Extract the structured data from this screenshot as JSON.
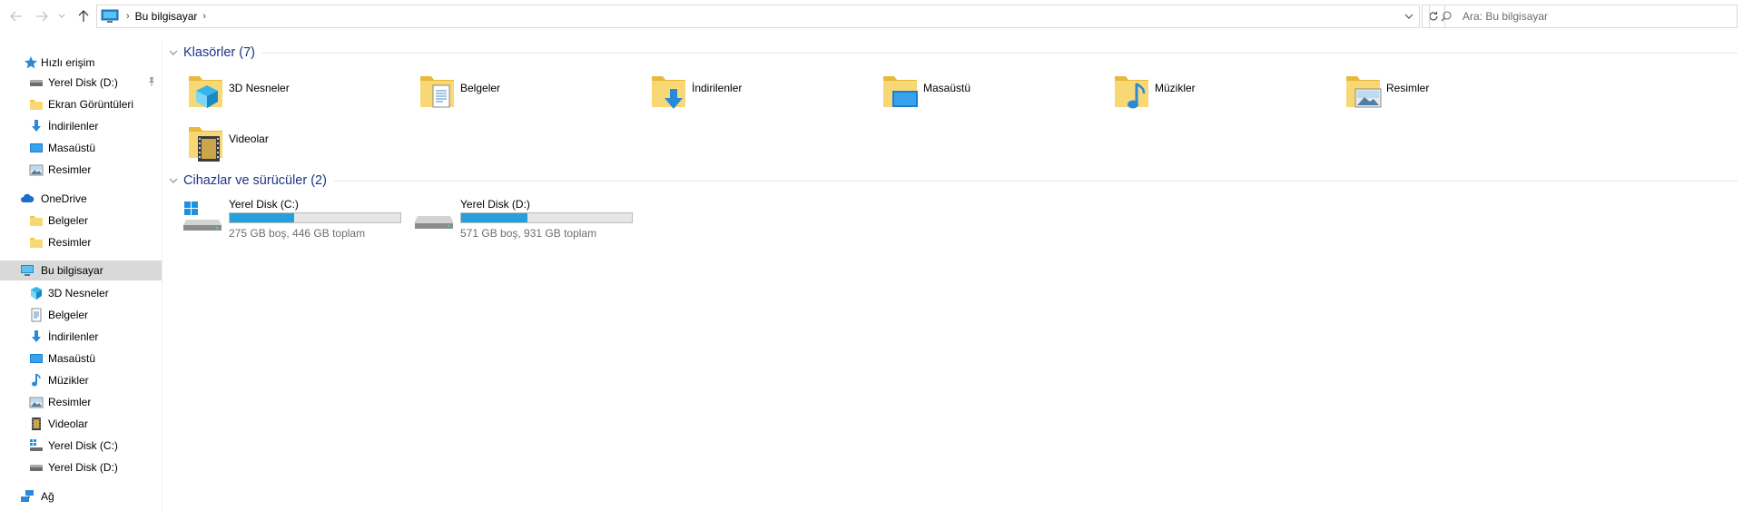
{
  "address_bar": {
    "breadcrumb": [
      "Bu bilgisayar"
    ],
    "search_placeholder": "Ara: Bu bilgisayar"
  },
  "sidebar": {
    "quick_access": {
      "label": "Hızlı erişim",
      "items": [
        {
          "label": "Yerel Disk (D:)",
          "icon": "drive-icon",
          "pinned": true
        },
        {
          "label": "Ekran Görüntüleri",
          "icon": "folder-icon"
        },
        {
          "label": "İndirilenler",
          "icon": "download-arrow-icon"
        },
        {
          "label": "Masaüstü",
          "icon": "desktop-icon"
        },
        {
          "label": "Resimler",
          "icon": "pictures-icon"
        }
      ]
    },
    "onedrive": {
      "label": "OneDrive",
      "items": [
        {
          "label": "Belgeler",
          "icon": "folder-icon"
        },
        {
          "label": "Resimler",
          "icon": "folder-icon"
        }
      ]
    },
    "this_pc": {
      "label": "Bu bilgisayar",
      "selected": true,
      "items": [
        {
          "label": "3D Nesneler",
          "icon": "3d-objects-icon"
        },
        {
          "label": "Belgeler",
          "icon": "documents-icon"
        },
        {
          "label": "İndirilenler",
          "icon": "download-arrow-icon"
        },
        {
          "label": "Masaüstü",
          "icon": "desktop-icon"
        },
        {
          "label": "Müzikler",
          "icon": "music-note-icon"
        },
        {
          "label": "Resimler",
          "icon": "pictures-icon"
        },
        {
          "label": "Videolar",
          "icon": "film-icon"
        },
        {
          "label": "Yerel Disk (C:)",
          "icon": "windows-drive-icon"
        },
        {
          "label": "Yerel Disk (D:)",
          "icon": "drive-icon"
        }
      ]
    },
    "network": {
      "label": "Ağ"
    }
  },
  "content": {
    "folders_group": {
      "title": "Klasörler (7)",
      "items": [
        {
          "label": "3D Nesneler",
          "icon": "3d-objects-folder-icon"
        },
        {
          "label": "Belgeler",
          "icon": "documents-folder-icon"
        },
        {
          "label": "İndirilenler",
          "icon": "downloads-folder-icon"
        },
        {
          "label": "Masaüstü",
          "icon": "desktop-folder-icon"
        },
        {
          "label": "Müzikler",
          "icon": "music-folder-icon"
        },
        {
          "label": "Resimler",
          "icon": "pictures-folder-icon"
        },
        {
          "label": "Videolar",
          "icon": "videos-folder-icon"
        }
      ]
    },
    "drives_group": {
      "title": "Cihazlar ve sürücüler (2)",
      "items": [
        {
          "label": "Yerel Disk (C:)",
          "info": "275 GB boş, 446 GB toplam",
          "used_fraction": 0.38,
          "icon": "windows-drive-icon"
        },
        {
          "label": "Yerel Disk (D:)",
          "info": "571 GB boş, 931 GB toplam",
          "used_fraction": 0.39,
          "icon": "drive-icon"
        }
      ]
    }
  },
  "colors": {
    "accent_text": "#1e3287",
    "selection": "#d9d9d9",
    "drive_bar_fill": "#26a0da",
    "folder_yellow": "#f8d775"
  }
}
